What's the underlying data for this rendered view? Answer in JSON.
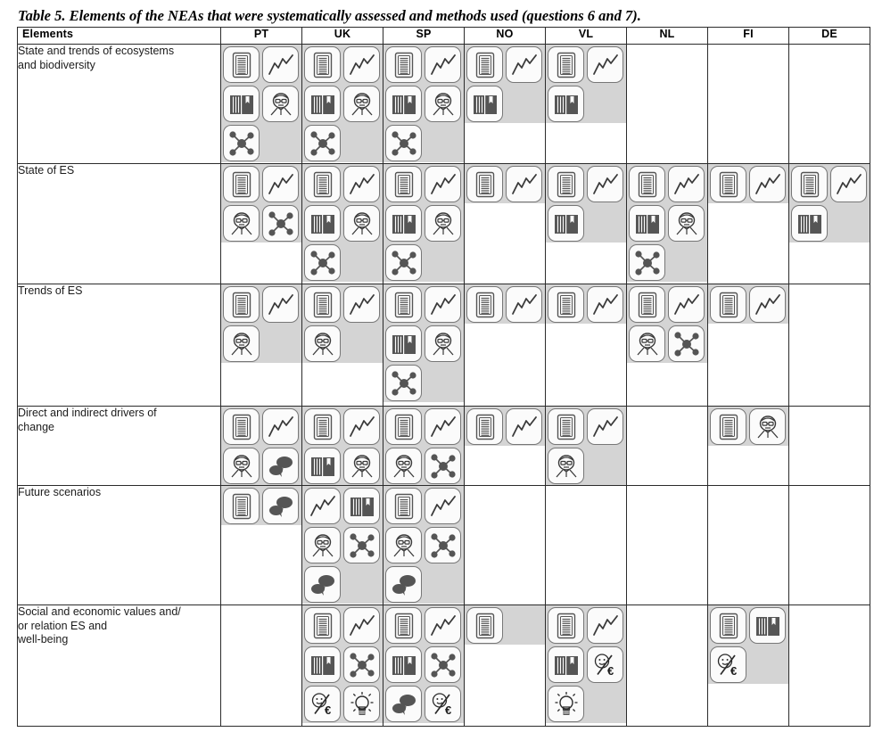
{
  "caption": "Table 5. Elements of the NEAs that were systematically assessed and methods used (questions 6 and 7).",
  "columns": [
    {
      "key": "elements",
      "label": "Elements"
    },
    {
      "key": "PT",
      "label": "PT"
    },
    {
      "key": "UK",
      "label": "UK"
    },
    {
      "key": "SP",
      "label": "SP"
    },
    {
      "key": "NO",
      "label": "NO"
    },
    {
      "key": "VL",
      "label": "VL"
    },
    {
      "key": "NL",
      "label": "NL"
    },
    {
      "key": "FI",
      "label": "FI"
    },
    {
      "key": "DE",
      "label": "DE"
    }
  ],
  "icon_legend": {
    "document": "document-icon",
    "chart": "line-chart-icon",
    "book": "book-literature-icon",
    "expert": "expert-person-icon",
    "network": "network-model-icon",
    "dialogue": "speech-bubbles-icon",
    "money": "monetary-valuation-icon",
    "bulb": "lightbulb-icon"
  },
  "colors": {
    "cell_shading": "#d4d4d4",
    "icon_fill": "#fbfbfb",
    "icon_border": "#777777",
    "icon_glyph": "#555555",
    "border": "#2b2b2b",
    "text": "#1c1c1c"
  },
  "rows": [
    {
      "label": "State and trends of ecosystems\nand biodiversity",
      "cells": {
        "PT": [
          "document",
          "chart",
          "book",
          "expert",
          "network"
        ],
        "UK": [
          "document",
          "chart",
          "book",
          "expert",
          "network"
        ],
        "SP": [
          "document",
          "chart",
          "book",
          "expert",
          "network"
        ],
        "NO": [
          "document",
          "chart",
          "book"
        ],
        "VL": [
          "document",
          "chart",
          "book"
        ],
        "NL": [],
        "FI": [],
        "DE": []
      }
    },
    {
      "label": "State of ES",
      "cells": {
        "PT": [
          "document",
          "chart",
          "expert",
          "network"
        ],
        "UK": [
          "document",
          "chart",
          "book",
          "expert",
          "network"
        ],
        "SP": [
          "document",
          "chart",
          "book",
          "expert",
          "network"
        ],
        "NO": [
          "document",
          "chart"
        ],
        "VL": [
          "document",
          "chart",
          "book"
        ],
        "NL": [
          "document",
          "chart",
          "book",
          "expert",
          "network"
        ],
        "FI": [
          "document",
          "chart"
        ],
        "DE": [
          "document",
          "chart",
          "book"
        ]
      }
    },
    {
      "label": "Trends of ES",
      "cells": {
        "PT": [
          "document",
          "chart",
          "expert"
        ],
        "UK": [
          "document",
          "chart",
          "expert"
        ],
        "SP": [
          "document",
          "chart",
          "book",
          "expert",
          "network"
        ],
        "NO": [
          "document",
          "chart"
        ],
        "VL": [
          "document",
          "chart"
        ],
        "NL": [
          "document",
          "chart",
          "expert",
          "network"
        ],
        "FI": [
          "document",
          "chart"
        ],
        "DE": []
      }
    },
    {
      "label": "Direct and indirect drivers of\nchange",
      "cells": {
        "PT": [
          "document",
          "chart",
          "expert",
          "dialogue"
        ],
        "UK": [
          "document",
          "chart",
          "book",
          "expert"
        ],
        "SP": [
          "document",
          "chart",
          "expert",
          "network"
        ],
        "NO": [
          "document",
          "chart"
        ],
        "VL": [
          "document",
          "chart",
          "expert"
        ],
        "NL": [],
        "FI": [
          "document",
          "expert"
        ],
        "DE": []
      }
    },
    {
      "label": "Future scenarios",
      "cells": {
        "PT": [
          "document",
          "dialogue"
        ],
        "UK": [
          "chart",
          "book",
          "expert",
          "network",
          "dialogue"
        ],
        "SP": [
          "document",
          "chart",
          "expert",
          "network",
          "dialogue"
        ],
        "NO": [],
        "VL": [],
        "NL": [],
        "FI": [],
        "DE": []
      }
    },
    {
      "label": "Social and economic values and/\nor relation ES and\nwell-being",
      "cells": {
        "PT": [],
        "UK": [
          "document",
          "chart",
          "book",
          "network",
          "money",
          "bulb"
        ],
        "SP": [
          "document",
          "chart",
          "book",
          "network",
          "dialogue",
          "money"
        ],
        "NO": [
          "document"
        ],
        "VL": [
          "document",
          "chart",
          "book",
          "money",
          "bulb"
        ],
        "NL": [],
        "FI": [
          "document",
          "book",
          "money"
        ],
        "DE": []
      }
    }
  ]
}
